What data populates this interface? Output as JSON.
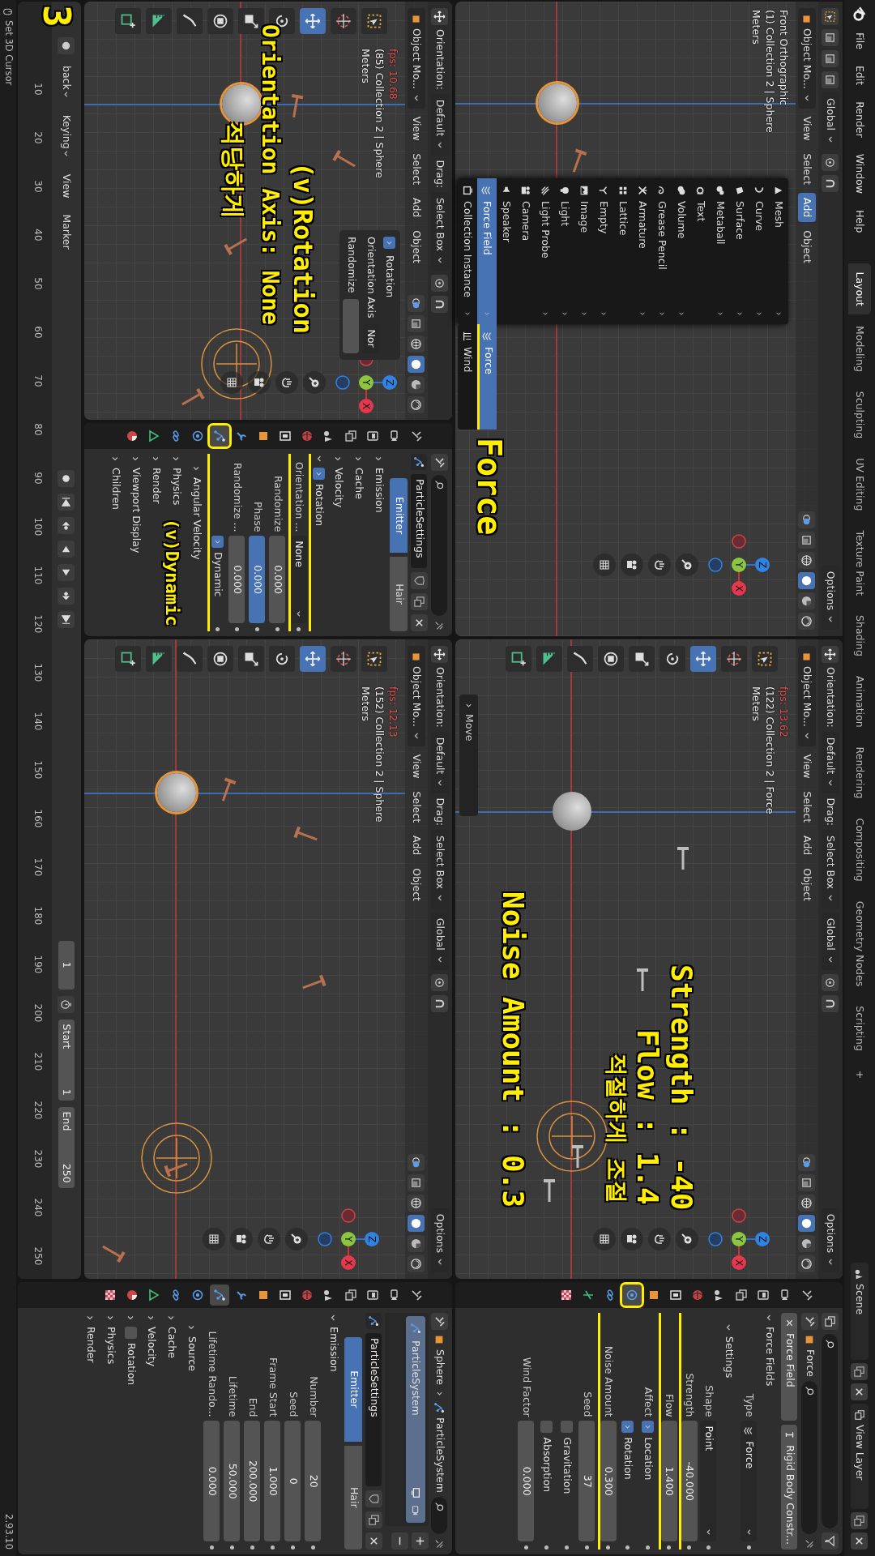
{
  "top_bar": {
    "menus": [
      "File",
      "Edit",
      "Render",
      "Window",
      "Help"
    ],
    "workspaces": [
      {
        "label": "Layout",
        "selected": true
      },
      {
        "label": "Modeling",
        "selected": false
      },
      {
        "label": "Sculpting",
        "selected": false
      },
      {
        "label": "UV Editing",
        "selected": false
      },
      {
        "label": "Texture Paint",
        "selected": false
      },
      {
        "label": "Shading",
        "selected": false
      },
      {
        "label": "Animation",
        "selected": false
      },
      {
        "label": "Rendering",
        "selected": false
      },
      {
        "label": "Compositing",
        "selected": false
      },
      {
        "label": "Geometry Nodes",
        "selected": false
      },
      {
        "label": "Scripting",
        "selected": false
      }
    ],
    "add_workspace": "+",
    "scene": "Scene",
    "view_layer": "View Layer"
  },
  "viewports": [
    {
      "tool_header": [
        {
          "kind": "dropdown",
          "text": "Global"
        }
      ],
      "options": "Options",
      "header": {
        "mode": "Object Mo...",
        "menus": [
          {
            "label": "View",
            "selected": false
          },
          {
            "label": "Select",
            "selected": false
          },
          {
            "label": "Add",
            "selected": true
          },
          {
            "label": "Object",
            "selected": false
          }
        ]
      },
      "info": [
        "Front Orthographic",
        "(1) Collection 2 | Sphere",
        "Meters"
      ],
      "sphere": {
        "selected": true
      },
      "gizmo": [
        "X",
        "Y",
        "Z"
      ],
      "menu": {
        "items": [
          {
            "label": "Mesh",
            "has_submenu": true,
            "selected": false
          },
          {
            "label": "Curve",
            "has_submenu": true,
            "selected": false
          },
          {
            "label": "Surface",
            "has_submenu": true,
            "selected": false
          },
          {
            "label": "Metaball",
            "has_submenu": true,
            "selected": false
          },
          {
            "label": "Text",
            "has_submenu": false,
            "selected": false
          },
          {
            "label": "Volume",
            "has_submenu": true,
            "selected": false
          },
          {
            "label": "Grease Pencil",
            "has_submenu": true,
            "selected": false
          },
          {
            "label": "Armature",
            "has_submenu": true,
            "selected": false
          },
          {
            "label": "Lattice",
            "has_submenu": false,
            "selected": false
          },
          {
            "label": "Empty",
            "has_submenu": true,
            "selected": false
          },
          {
            "label": "Image",
            "has_submenu": true,
            "selected": false
          },
          {
            "label": "Light",
            "has_submenu": true,
            "selected": false
          },
          {
            "label": "Light Probe",
            "has_submenu": true,
            "selected": false
          },
          {
            "label": "Camera",
            "has_submenu": false,
            "selected": false
          },
          {
            "label": "Speaker",
            "has_submenu": false,
            "selected": false
          },
          {
            "label": "Force Field",
            "has_submenu": true,
            "selected": true
          },
          {
            "label": "Collection Instance",
            "has_submenu": true,
            "selected": false
          }
        ],
        "submenu": [
          {
            "label": "Force",
            "selected": true,
            "marked": true
          },
          {
            "label": "Wind",
            "selected": false,
            "marked": false
          }
        ]
      }
    },
    {
      "tool_header": [
        {
          "kind": "text",
          "text": "Orientation:"
        },
        {
          "kind": "dropdown",
          "text": "Default"
        },
        {
          "kind": "text",
          "text": "Drag:"
        },
        {
          "kind": "dropdown",
          "text": "Select Box"
        },
        {
          "kind": "dropdown",
          "text": "Global"
        }
      ],
      "options": "Options",
      "header": {
        "mode": "Object Mo...",
        "menus": [
          {
            "label": "View",
            "selected": false
          },
          {
            "label": "Select",
            "selected": false
          },
          {
            "label": "Add",
            "selected": false
          },
          {
            "label": "Object",
            "selected": false
          }
        ]
      },
      "fps": "fps: 13.62",
      "info": [
        "(122) Collection 2 | Force",
        "Meters"
      ],
      "sphere": {
        "selected": false
      },
      "gizmo": [
        "X",
        "Y",
        "Z"
      ],
      "toolbar": [
        {
          "kind": "select",
          "selected": false
        },
        {
          "kind": "cursor",
          "selected": false
        },
        {
          "kind": "move",
          "selected": true
        },
        {
          "kind": "rotate",
          "selected": false
        },
        {
          "kind": "scale",
          "selected": false
        },
        {
          "kind": "transform",
          "selected": false
        },
        {
          "kind": "annotate",
          "selected": false
        },
        {
          "kind": "measure",
          "selected": false
        },
        {
          "kind": "add_cube",
          "selected": false
        }
      ],
      "last_operator": "Move"
    },
    {
      "tool_header": [
        {
          "kind": "text",
          "text": "Orientation:"
        },
        {
          "kind": "dropdown",
          "text": "Default"
        },
        {
          "kind": "text",
          "text": "Drag:"
        },
        {
          "kind": "dropdown",
          "text": "Select Box"
        }
      ],
      "header": {
        "mode": "Object Mo...",
        "menus": [
          {
            "label": "View",
            "selected": false
          },
          {
            "label": "Select",
            "selected": false
          },
          {
            "label": "Add",
            "selected": false
          },
          {
            "label": "Object",
            "selected": false
          }
        ]
      },
      "fps": "fps: 10.68",
      "info": [
        "(85) Collection 2 | Sphere",
        "Meters"
      ],
      "sphere": {
        "selected": true
      },
      "gizmo": [
        "X",
        "Y",
        "Z"
      ],
      "toolbar": [
        {
          "kind": "select",
          "selected": false
        },
        {
          "kind": "cursor",
          "selected": false
        },
        {
          "kind": "move",
          "selected": true
        },
        {
          "kind": "rotate",
          "selected": false
        },
        {
          "kind": "scale",
          "selected": false
        },
        {
          "kind": "transform",
          "selected": false
        },
        {
          "kind": "annotate",
          "selected": false
        },
        {
          "kind": "measure",
          "selected": false
        },
        {
          "kind": "add_cube",
          "selected": false
        }
      ],
      "popover": {
        "title": "Rotation",
        "checked": true,
        "rows": [
          {
            "label": "Orientation Axis",
            "value": "Nor"
          },
          {
            "label": "Randomize"
          }
        ]
      }
    },
    {
      "tool_header": [
        {
          "kind": "text",
          "text": "Orientation:"
        },
        {
          "kind": "dropdown",
          "text": "Default"
        },
        {
          "kind": "text",
          "text": "Drag:"
        },
        {
          "kind": "dropdown",
          "text": "Select Box"
        },
        {
          "kind": "dropdown",
          "text": "Global"
        }
      ],
      "options": "Options",
      "header": {
        "mode": "Object Mo...",
        "menus": [
          {
            "label": "View",
            "selected": false
          },
          {
            "label": "Select",
            "selected": false
          },
          {
            "label": "Add",
            "selected": false
          },
          {
            "label": "Object",
            "selected": false
          }
        ]
      },
      "fps": "fps: 12.13",
      "info": [
        "(152) Collection 2 | Sphere",
        "Meters"
      ],
      "sphere": {
        "selected": true
      },
      "gizmo": [
        "X",
        "Y",
        "Z"
      ],
      "toolbar": [
        {
          "kind": "select",
          "selected": false
        },
        {
          "kind": "cursor",
          "selected": false
        },
        {
          "kind": "move",
          "selected": true
        },
        {
          "kind": "rotate",
          "selected": false
        },
        {
          "kind": "scale",
          "selected": false
        },
        {
          "kind": "transform",
          "selected": false
        },
        {
          "kind": "annotate",
          "selected": false
        },
        {
          "kind": "measure",
          "selected": false
        },
        {
          "kind": "add_cube",
          "selected": false
        }
      ]
    }
  ],
  "properties": [
    {
      "tabs": [
        {
          "kind": "tool",
          "selected": false,
          "highlighted": false
        },
        {
          "kind": "render",
          "selected": false,
          "highlighted": false
        },
        {
          "kind": "output",
          "selected": false,
          "highlighted": false
        },
        {
          "kind": "view_layer",
          "selected": false,
          "highlighted": false
        },
        {
          "kind": "scene",
          "selected": false,
          "highlighted": false
        },
        {
          "kind": "world",
          "selected": false,
          "highlighted": false
        },
        {
          "kind": "collection",
          "selected": false,
          "highlighted": false
        },
        {
          "kind": "object",
          "selected": false,
          "highlighted": false
        },
        {
          "kind": "physics",
          "selected": true,
          "highlighted": true
        },
        {
          "kind": "constraints",
          "selected": false,
          "highlighted": false
        },
        {
          "kind": "data_empty",
          "selected": false,
          "highlighted": false
        },
        {
          "kind": "texture",
          "selected": false,
          "highlighted": false
        }
      ],
      "title": "Force",
      "rows": [
        {
          "kind": "buttons",
          "items": [
            {
              "text": "Force Field"
            },
            {
              "text": "Rigid Body Constr..."
            }
          ]
        },
        {
          "kind": "panel",
          "label": "Force Fields",
          "expanded": true
        },
        {
          "kind": "dropdown_icon",
          "label": "Type",
          "value": "Force"
        },
        {
          "kind": "subpanel",
          "label": "Settings",
          "expanded": true
        },
        {
          "kind": "dropdown",
          "label": "Shape",
          "value": "Point"
        },
        {
          "kind": "number",
          "label": "Strength",
          "value": "-40.000",
          "marked": true
        },
        {
          "kind": "number",
          "label": "Flow",
          "value": "1.400",
          "marked": true
        },
        {
          "kind": "check",
          "label": "Affect",
          "text": "Location",
          "checked": true
        },
        {
          "kind": "check",
          "text": "Rotation",
          "checked": true
        },
        {
          "kind": "number",
          "label": "Noise Amount",
          "value": "0.300",
          "marked": true
        },
        {
          "kind": "number",
          "label": "Seed",
          "value": "37"
        },
        {
          "kind": "check",
          "text": "Gravitation",
          "checked": false
        },
        {
          "kind": "check",
          "text": "Absorption",
          "checked": false
        },
        {
          "kind": "number",
          "label": "Wind Factor",
          "value": "0.000"
        }
      ]
    },
    {
      "tabs": [
        {
          "kind": "tool",
          "selected": false,
          "highlighted": false
        },
        {
          "kind": "render",
          "selected": false,
          "highlighted": false
        },
        {
          "kind": "output",
          "selected": false,
          "highlighted": false
        },
        {
          "kind": "view_layer",
          "selected": false,
          "highlighted": false
        },
        {
          "kind": "scene",
          "selected": false,
          "highlighted": false
        },
        {
          "kind": "world",
          "selected": false,
          "highlighted": false
        },
        {
          "kind": "collection",
          "selected": false,
          "highlighted": false
        },
        {
          "kind": "object",
          "selected": false,
          "highlighted": false
        },
        {
          "kind": "modifiers",
          "selected": false,
          "highlighted": false
        },
        {
          "kind": "particles",
          "selected": true,
          "highlighted": true
        },
        {
          "kind": "physics",
          "selected": false,
          "highlighted": false
        },
        {
          "kind": "constraints",
          "selected": false,
          "highlighted": false
        },
        {
          "kind": "data_mesh",
          "selected": false,
          "highlighted": false
        },
        {
          "kind": "material",
          "selected": false,
          "highlighted": false
        }
      ],
      "rows": [
        {
          "kind": "datablock",
          "text": "ParticleSettings"
        },
        {
          "kind": "segmented",
          "items": [
            {
              "text": "Emitter",
              "selected": true
            },
            {
              "text": "Hair",
              "selected": false
            }
          ]
        },
        {
          "kind": "panel",
          "label": "Emission",
          "expanded": false
        },
        {
          "kind": "panel",
          "label": "Cache",
          "expanded": false
        },
        {
          "kind": "panel",
          "label": "Velocity",
          "expanded": false
        },
        {
          "kind": "panel",
          "label": "Rotation",
          "expanded": true,
          "checked": true,
          "marked": true
        },
        {
          "kind": "dropdown",
          "label": "Orientation ...",
          "value": "None",
          "marked": true
        },
        {
          "kind": "number",
          "label": "Randomize",
          "value": "0.000"
        },
        {
          "kind": "number",
          "label": "Phase",
          "value": "0.000",
          "highlighted": true
        },
        {
          "kind": "number",
          "label": "Randomize ...",
          "value": "0.000"
        },
        {
          "kind": "check",
          "text": "Dynamic",
          "checked": true,
          "marked": true
        },
        {
          "kind": "subpanel",
          "label": "Angular Velocity",
          "expanded": false
        },
        {
          "kind": "panel",
          "label": "Physics",
          "expanded": false
        },
        {
          "kind": "panel",
          "label": "Render",
          "expanded": false
        },
        {
          "kind": "panel",
          "label": "Viewport Display",
          "expanded": false
        },
        {
          "kind": "panel",
          "label": "Children",
          "expanded": false
        }
      ]
    },
    {
      "tabs": [
        {
          "kind": "tool",
          "selected": false,
          "highlighted": false
        },
        {
          "kind": "render",
          "selected": false,
          "highlighted": false
        },
        {
          "kind": "output",
          "selected": false,
          "highlighted": false
        },
        {
          "kind": "view_layer",
          "selected": false,
          "highlighted": false
        },
        {
          "kind": "scene",
          "selected": false,
          "highlighted": false
        },
        {
          "kind": "world",
          "selected": false,
          "highlighted": false
        },
        {
          "kind": "collection",
          "selected": false,
          "highlighted": false
        },
        {
          "kind": "object",
          "selected": false,
          "highlighted": false
        },
        {
          "kind": "modifiers",
          "selected": false,
          "highlighted": false
        },
        {
          "kind": "particles",
          "selected": true,
          "highlighted": false
        },
        {
          "kind": "physics",
          "selected": false,
          "highlighted": false
        },
        {
          "kind": "constraints",
          "selected": false,
          "highlighted": false
        },
        {
          "kind": "data_mesh",
          "selected": false,
          "highlighted": false
        },
        {
          "kind": "material",
          "selected": false,
          "highlighted": false
        },
        {
          "kind": "texture",
          "selected": false,
          "highlighted": false
        }
      ],
      "path": [
        "Sphere",
        "ParticleSystem"
      ],
      "list": [
        {
          "text": "ParticleSystem",
          "selected": true
        }
      ],
      "rows": [
        {
          "kind": "datablock",
          "text": "ParticleSettings"
        },
        {
          "kind": "segmented",
          "items": [
            {
              "text": "Emitter",
              "selected": true
            },
            {
              "text": "Hair",
              "selected": false
            }
          ]
        },
        {
          "kind": "panel",
          "label": "Emission",
          "expanded": true
        },
        {
          "kind": "number",
          "label": "Number",
          "value": "20"
        },
        {
          "kind": "number",
          "label": "Seed",
          "value": "0"
        },
        {
          "kind": "number",
          "label": "Frame Start",
          "value": "1.000"
        },
        {
          "kind": "number",
          "label": "End",
          "value": "200.000"
        },
        {
          "kind": "number",
          "label": "Lifetime",
          "value": "50.000"
        },
        {
          "kind": "number",
          "label": "Lifetime Rando...",
          "value": "0.000"
        },
        {
          "kind": "subpanel",
          "label": "Source",
          "expanded": false
        },
        {
          "kind": "panel",
          "label": "Cache",
          "expanded": false
        },
        {
          "kind": "panel",
          "label": "Velocity",
          "expanded": false
        },
        {
          "kind": "panel",
          "label": "Rotation",
          "expanded": false,
          "checked": false
        },
        {
          "kind": "panel",
          "label": "Physics",
          "expanded": false
        },
        {
          "kind": "panel",
          "label": "Render",
          "expanded": false
        }
      ]
    }
  ],
  "timeline": {
    "header": [
      {
        "kind": "dropdown",
        "text": "back"
      },
      {
        "kind": "dropdown",
        "text": "Keying"
      },
      {
        "kind": "menu",
        "text": "View"
      },
      {
        "kind": "menu",
        "text": "Marker"
      }
    ],
    "current_frame": "1",
    "start": {
      "label": "Start",
      "value": "1"
    },
    "end": {
      "label": "End",
      "value": "250"
    },
    "ruler": [
      "10",
      "20",
      "30",
      "40",
      "50",
      "60",
      "70",
      "80",
      "90",
      "100",
      "110",
      "120",
      "130",
      "140",
      "150",
      "160",
      "170",
      "180",
      "190",
      "200",
      "210",
      "220",
      "230",
      "240",
      "250"
    ]
  },
  "status_bar": {
    "hint": "Set 3D Cursor",
    "version": "2.93.10"
  },
  "annotations": [
    {
      "text": "3"
    },
    {
      "text": "(v)Rotation"
    },
    {
      "text": "Orientation Axis: None"
    },
    {
      "text": "적당하게"
    },
    {
      "text": "Force"
    },
    {
      "text": "(v)Dynamic"
    },
    {
      "text": "적절하게 조절"
    },
    {
      "text": "Strength : -40"
    },
    {
      "text": "Flow : 1.4"
    },
    {
      "text": "Noise Amount : 0.3"
    }
  ]
}
